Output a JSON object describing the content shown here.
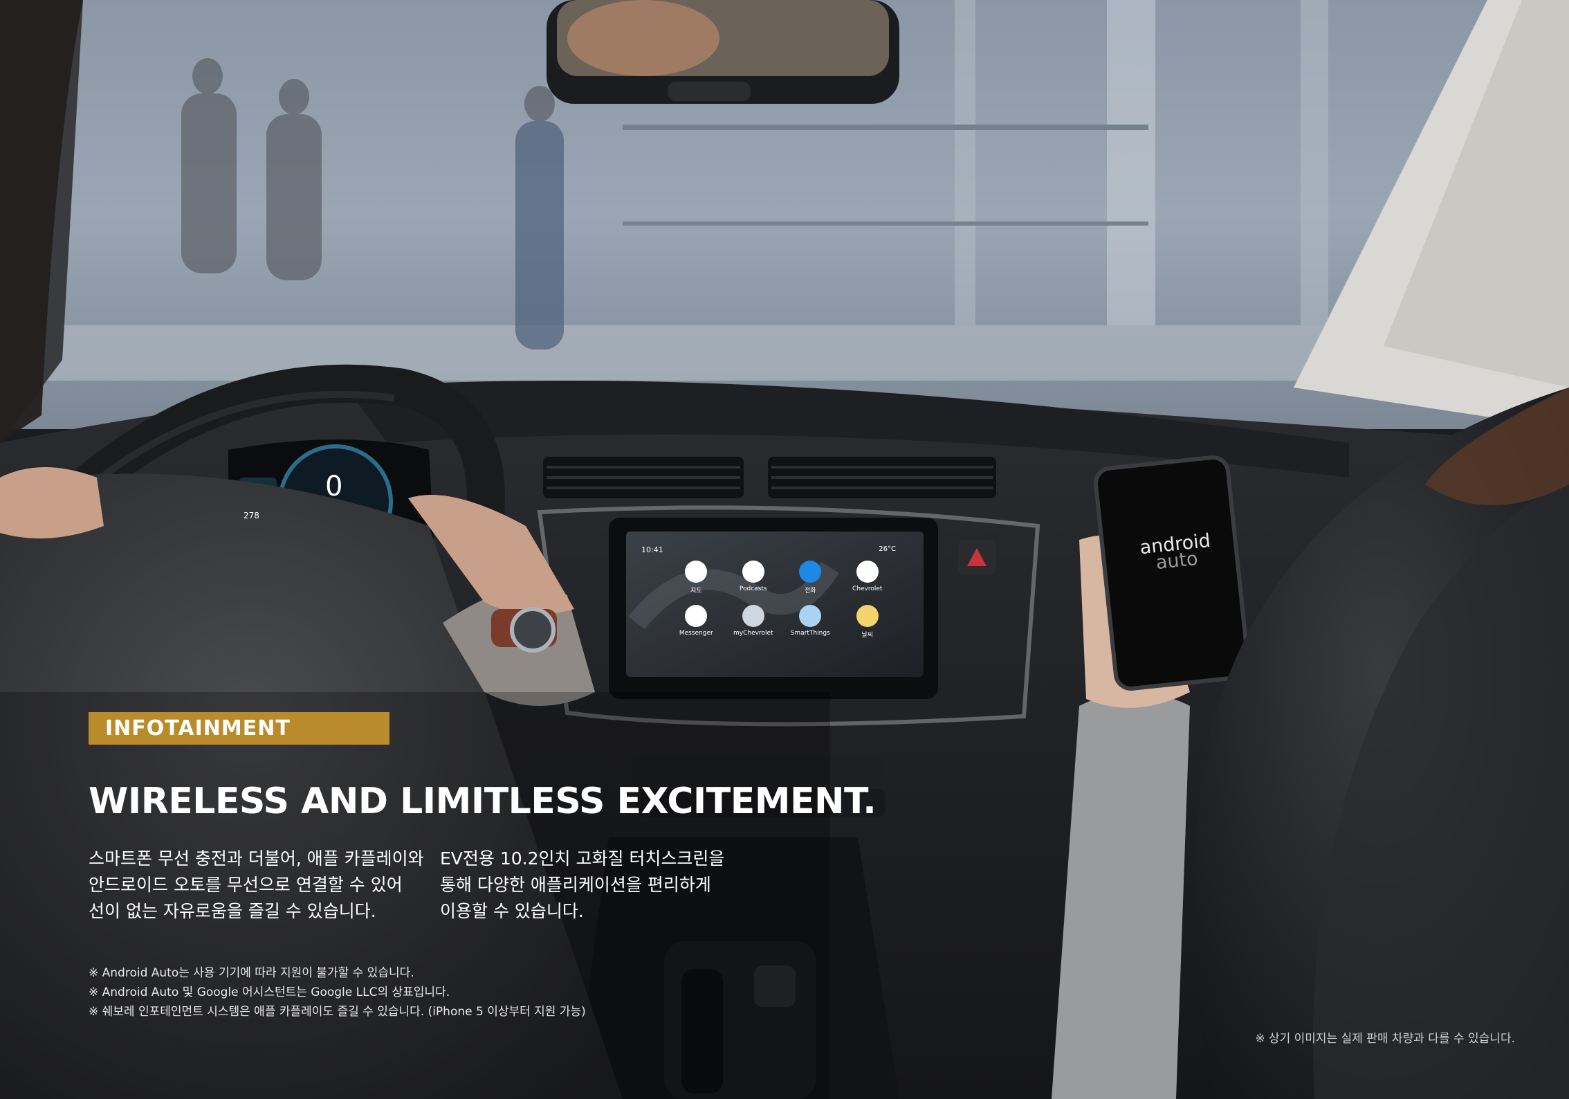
{
  "section_tag": "INFOTAINMENT",
  "headline": "WIRELESS AND LIMITLESS EXCITEMENT.",
  "body_left": [
    "스마트폰 무선 충전과 더불어, 애플 카플레이와",
    "안드로이드 오토를 무선으로 연결할 수 있어",
    "선이 없는 자유로움을 즐길 수 있습니다."
  ],
  "body_right": [
    "EV전용 10.2인치 고화질 터치스크린을",
    "통해 다양한 애플리케이션을 편리하게",
    "이용할 수 있습니다."
  ],
  "notes": [
    "※ Android Auto는 사용 기기에 따라 지원이 불가할 수 있습니다.",
    "※ Android Auto 및 Google 어시스턴트는 Google LLC의 상표입니다.",
    "※ 쉐보레 인포테인먼트 시스템은 애플 카플레이도 즐길 수 있습니다. (iPhone 5 이상부터 지원 가능)"
  ],
  "disclaimer": "※ 상기 이미지는 실제 판매 차량과 다를 수 있습니다.",
  "screen": {
    "time": "10:41",
    "temperature": "26°C",
    "apps": [
      "지도",
      "Podcasts",
      "전화",
      "Chevrolet",
      "Messenger",
      "myChevrolet",
      "SmartThings",
      "날씨"
    ]
  },
  "cluster": {
    "speed": "0",
    "range": "278"
  },
  "phone": {
    "logo_line1": "android",
    "logo_line2": "auto"
  },
  "colors": {
    "accent_gold": "#b98b2a"
  }
}
